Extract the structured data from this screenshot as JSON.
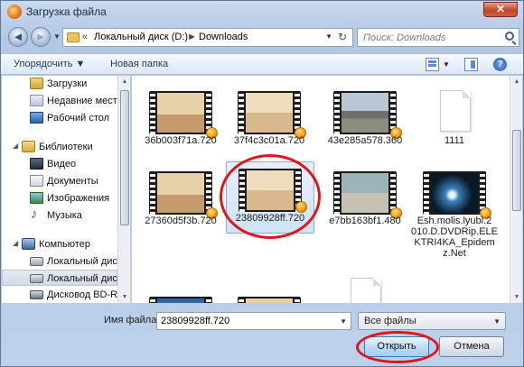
{
  "window": {
    "title": "Загрузка файла",
    "close_label": "✕"
  },
  "nav": {
    "back_label": "◄",
    "forward_label": "►",
    "breadcrumbs": [
      "Локальный диск (D:)",
      "Downloads"
    ],
    "search_placeholder": "Поиск: Downloads"
  },
  "toolbar": {
    "organize_label": "Упорядочить ▼",
    "new_folder_label": "Новая папка",
    "help_label": "?"
  },
  "sidebar": {
    "items": [
      {
        "label": "Загрузки",
        "icon": "downloads-folder-icon"
      },
      {
        "label": "Недавние места",
        "icon": "recent-places-icon"
      },
      {
        "label": "Рабочий стол",
        "icon": "desktop-icon"
      },
      {
        "label": "Библиотеки",
        "icon": "libraries-icon"
      },
      {
        "label": "Видео",
        "icon": "video-library-icon"
      },
      {
        "label": "Документы",
        "icon": "documents-icon"
      },
      {
        "label": "Изображения",
        "icon": "pictures-icon"
      },
      {
        "label": "Музыка",
        "icon": "music-icon"
      },
      {
        "label": "Компьютер",
        "icon": "computer-icon"
      },
      {
        "label": "Локальный диск",
        "icon": "local-disk-icon"
      },
      {
        "label": "Локальный диск",
        "icon": "local-disk-icon"
      },
      {
        "label": "Дисковод BD-RO",
        "icon": "bd-drive-icon"
      }
    ]
  },
  "files": [
    {
      "name": "36b003f71a.720",
      "type": "video"
    },
    {
      "name": "37f4c3c01a.720",
      "type": "video"
    },
    {
      "name": "43e285a578.360",
      "type": "video"
    },
    {
      "name": "1111",
      "type": "document"
    },
    {
      "name": "27360d5f3b.720",
      "type": "video"
    },
    {
      "name": "23809928ff.720",
      "type": "video",
      "selected": true
    },
    {
      "name": "e7bb163bf1.480",
      "type": "video"
    },
    {
      "name": "Esh.molis.lyubi.2\n010.D.DVDRip.ELE\nKTRI4KA_Epidem\nz.Net",
      "type": "video"
    },
    {
      "name": "",
      "type": "video"
    },
    {
      "name": "",
      "type": "video"
    },
    {
      "name": "",
      "type": "document"
    }
  ],
  "bottom": {
    "filename_label": "Имя файла:",
    "filename_value": "23809928ff.720",
    "filetype_value": "Все файлы",
    "open_label": "Открыть",
    "cancel_label": "Отмена"
  },
  "colors": {
    "highlight": "#e0151b",
    "selection": "#cfe2f7"
  }
}
